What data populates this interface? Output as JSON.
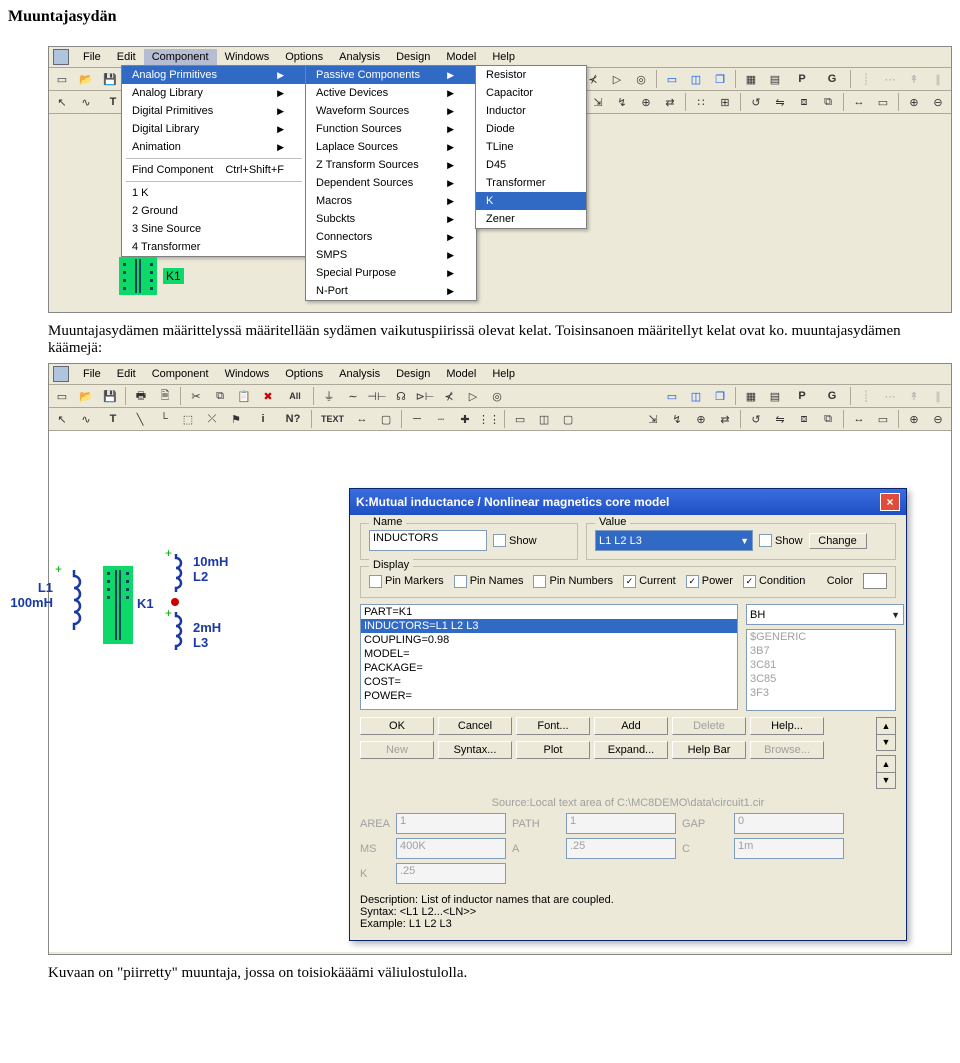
{
  "doc": {
    "title": "Muuntajasydän",
    "para1": "Muuntajasydämen määrittelyssä määritellään sydämen vaikutuspiirissä olevat kelat. Toisinsanoen määritellyt kelat ovat ko. muuntajasydämen käämejä:",
    "para2": "Kuvaan on \"piirretty\" muuntaja, jossa on toisiokääämi väliulostulolla."
  },
  "menubar": {
    "items": [
      "File",
      "Edit",
      "Component",
      "Windows",
      "Options",
      "Analysis",
      "Design",
      "Model",
      "Help"
    ],
    "active_index": 2
  },
  "toolbar_letters": {
    "p": "P",
    "g": "G",
    "t": "T",
    "text": "TEXT",
    "i": "i",
    "help": "N?"
  },
  "dropdown1": {
    "top": [
      "Analog Primitives",
      "Analog Library",
      "Digital Primitives",
      "Digital Library",
      "Animation"
    ],
    "sep_after_top": true,
    "find": {
      "label": "Find Component",
      "shortcut": "Ctrl+Shift+F"
    },
    "recent": [
      "1 K",
      "2 Ground",
      "3 Sine Source",
      "4 Transformer"
    ],
    "arrows_top": [
      true,
      true,
      true,
      true,
      true
    ]
  },
  "dropdown2": {
    "items": [
      "Passive Components",
      "Active Devices",
      "Waveform Sources",
      "Function Sources",
      "Laplace Sources",
      "Z Transform Sources",
      "Dependent Sources",
      "Macros",
      "Subckts",
      "Connectors",
      "SMPS",
      "Special Purpose",
      "N-Port"
    ],
    "arrows": [
      true,
      true,
      true,
      true,
      true,
      true,
      true,
      true,
      true,
      true,
      true,
      true,
      true
    ],
    "hl_index": 0
  },
  "dropdown3": {
    "items": [
      "Resistor",
      "Capacitor",
      "Inductor",
      "Diode",
      "TLine",
      "D45",
      "Transformer",
      "K",
      "Zener"
    ],
    "hl_index": 7
  },
  "k1": {
    "label": "K1"
  },
  "schematic": {
    "L1": {
      "name": "L1",
      "val": "100mH"
    },
    "L2": {
      "name": "L2",
      "val": "10mH"
    },
    "L3": {
      "name": "L3",
      "val": "2mH"
    },
    "K1": {
      "name": "K1"
    }
  },
  "dialog": {
    "title": "K:Mutual inductance / Nonlinear magnetics core model",
    "name_group": "Name",
    "name_value": "INDUCTORS",
    "show_lbl": "Show",
    "value_group": "Value",
    "value_value": "L1 L2 L3",
    "change_lbl": "Change",
    "display_group": "Display",
    "disp_checks": [
      "Pin Markers",
      "Pin Names",
      "Pin Numbers",
      "Current",
      "Power",
      "Condition"
    ],
    "disp_checked": [
      false,
      false,
      false,
      true,
      true,
      true
    ],
    "color_lbl": "Color",
    "paramlist": [
      "PART=K1",
      "INDUCTORS=L1 L2 L3",
      "COUPLING=0.98",
      "MODEL=",
      "PACKAGE=",
      "COST=",
      "POWER="
    ],
    "paramlist_sel": 1,
    "right_combo": "BH",
    "right_list": [
      "$GENERIC",
      "3B7",
      "3C81",
      "3C85",
      "3F3"
    ],
    "btnrow1": [
      "OK",
      "Cancel",
      "Font...",
      "Add",
      "Delete",
      "Help..."
    ],
    "btnrow1_dim": [
      false,
      false,
      false,
      false,
      true,
      false
    ],
    "btnrow2": [
      "New",
      "Syntax...",
      "Plot",
      "Expand...",
      "Help Bar",
      "Browse..."
    ],
    "btnrow2_dim": [
      true,
      false,
      false,
      false,
      false,
      true
    ],
    "source_line": "Source:Local text area of C:\\MC8DEMO\\data\\circuit1.cir",
    "grid": {
      "AREA": "1",
      "PATH": "1",
      "GAP": "0",
      "MS": "400K",
      "A": ".25",
      "C": "1m",
      "K": ".25"
    },
    "desc_label": "Description:",
    "desc": "List of inductor names that are coupled.",
    "syntax_label": "Syntax:",
    "syntax": "<L1 L2...<LN>>",
    "example_label": "Example:",
    "example": "L1 L2 L3"
  }
}
